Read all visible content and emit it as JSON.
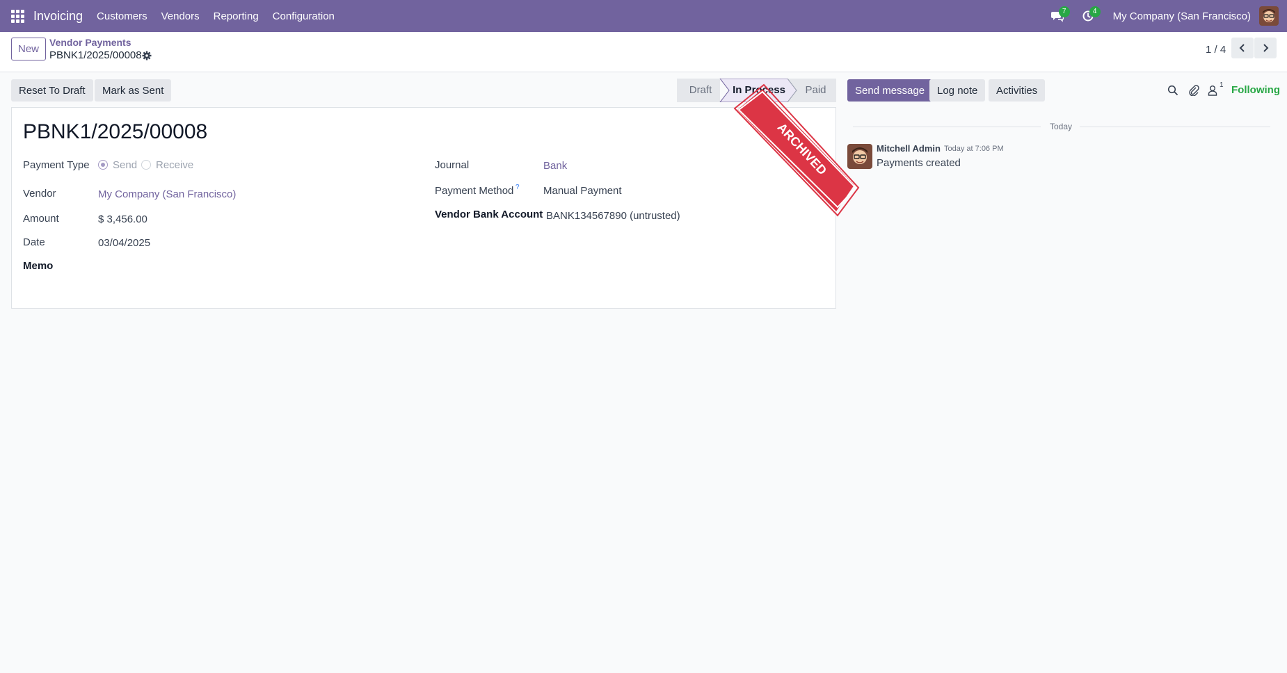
{
  "navbar": {
    "app_name": "Invoicing",
    "menu": [
      "Customers",
      "Vendors",
      "Reporting",
      "Configuration"
    ],
    "messages_badge": "7",
    "activities_badge": "4",
    "company": "My Company (San Francisco)",
    "brand_color": "#71639e"
  },
  "control_panel": {
    "new_label": "New",
    "breadcrumb_parent": "Vendor Payments",
    "breadcrumb_current": "PBNK1/2025/00008",
    "pager": "1 / 4"
  },
  "actions": {
    "reset_to_draft": "Reset To Draft",
    "mark_as_sent": "Mark as Sent"
  },
  "statusbar": {
    "steps": [
      "Draft",
      "In Process",
      "Paid"
    ],
    "current": "In Process"
  },
  "form": {
    "title": "PBNK1/2025/00008",
    "ribbon": "ARCHIVED",
    "payment_type_label": "Payment Type",
    "payment_type_options": [
      "Send",
      "Receive"
    ],
    "payment_type_selected": "Send",
    "vendor_label": "Vendor",
    "vendor_value": "My Company (San Francisco)",
    "amount_label": "Amount",
    "amount_value": "$ 3,456.00",
    "date_label": "Date",
    "date_value": "03/04/2025",
    "memo_label": "Memo",
    "journal_label": "Journal",
    "journal_value": "Bank",
    "payment_method_label": "Payment Method",
    "payment_method_help": "?",
    "payment_method_value": "Manual Payment",
    "bank_account_label": "Vendor Bank Account",
    "bank_account_value": "BANK134567890 (untrusted)"
  },
  "chatter": {
    "send_message": "Send message",
    "log_note": "Log note",
    "activities": "Activities",
    "follower_count": "1",
    "following": "Following",
    "separator": "Today",
    "message": {
      "author": "Mitchell Admin",
      "date": "Today at 7:06 PM",
      "body": "Payments created"
    }
  }
}
